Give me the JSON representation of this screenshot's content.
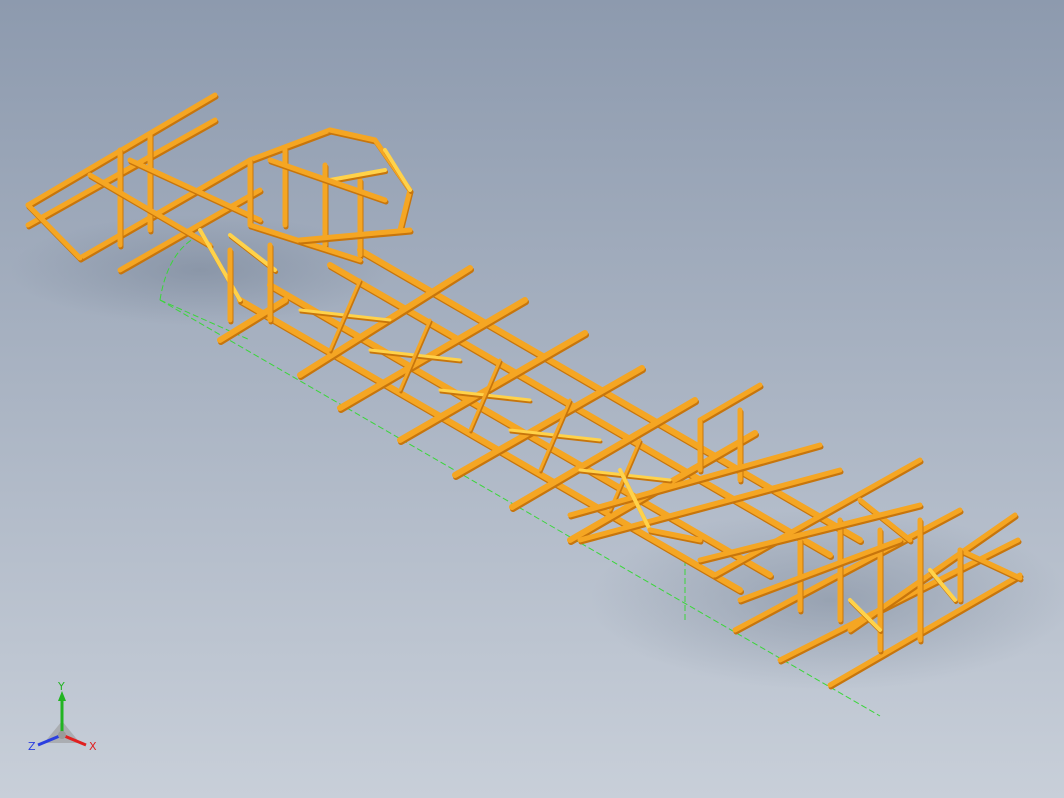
{
  "viewport": {
    "background_top": "#8d9aae",
    "background_bottom": "#c8cfd9",
    "model_color": "#f5a623",
    "model_highlight": "#ffd24a",
    "model_shadow": "#c7750c",
    "axis_line_color": "#3ad63a"
  },
  "triad": {
    "x_label": "X",
    "y_label": "Y",
    "z_label": "Z",
    "x_color": "#e02020",
    "y_color": "#22b422",
    "z_color": "#2a3ee0",
    "origin_color": "#9a9a9a"
  },
  "model": {
    "name": "",
    "icon": "truss-frame-icon"
  }
}
